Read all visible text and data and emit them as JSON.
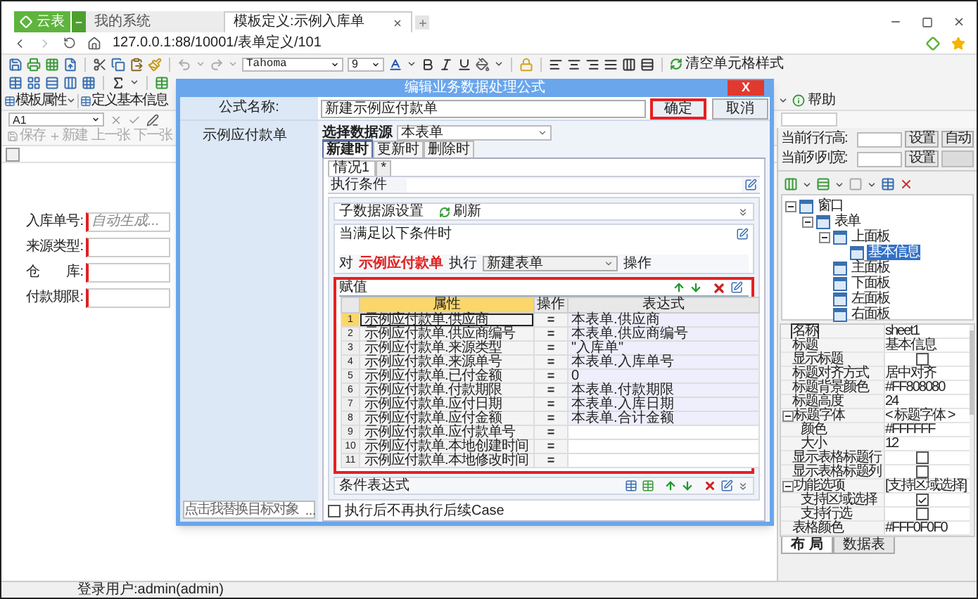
{
  "browser": {
    "tabs": [
      {
        "label": "云表",
        "selected": false,
        "kind": "brand"
      },
      {
        "label": "我的系统",
        "selected": false,
        "kind": "page"
      },
      {
        "label": "模板定义:示例入库单",
        "selected": true,
        "kind": "page"
      }
    ],
    "address": "127.0.0.1:88/10001/表单定义/101"
  },
  "toolbar": {
    "font": "Tahoma",
    "size": "9",
    "clear_style": "清空单元格样式"
  },
  "ribbon": {
    "template_props": "模板属性",
    "basic_info": "定义基本信息",
    "help": "帮助"
  },
  "formula_bar": {
    "cell": "A1"
  },
  "form_toolbar": [
    {
      "label": "保存",
      "disabled": true
    },
    {
      "label": "新建",
      "disabled": true
    },
    {
      "label": "上一张",
      "disabled": true
    },
    {
      "label": "下一张",
      "disabled": true
    }
  ],
  "sheet_fields": [
    {
      "label": "入库单号:",
      "placeholder": "自动生成..."
    },
    {
      "label": "来源类型:"
    },
    {
      "label": "仓　　库:"
    },
    {
      "label": "付款期限:"
    }
  ],
  "right_panel": {
    "size_rows": [
      {
        "label": "当前行行高:",
        "buttons": [
          "设置",
          "自动"
        ]
      },
      {
        "label": "当前列列宽:",
        "buttons": [
          "设置"
        ]
      }
    ],
    "tree": [
      {
        "label": "窗口",
        "selected": false,
        "expanded": true,
        "children": [
          {
            "label": "表单",
            "selected": false,
            "expanded": true,
            "children": [
              {
                "label": "上面板",
                "selected": false,
                "expanded": true,
                "children": [
                  {
                    "label": "基本信息",
                    "selected": true
                  }
                ]
              },
              {
                "label": "主面板",
                "selected": false
              },
              {
                "label": "下面板",
                "selected": false
              },
              {
                "label": "左面板",
                "selected": false
              },
              {
                "label": "右面板",
                "selected": false
              }
            ]
          }
        ]
      }
    ],
    "properties": [
      {
        "name": "名称",
        "value": "sheet1",
        "selected": true
      },
      {
        "name": "标题",
        "value": "基本信息",
        "selected": false
      },
      {
        "name": "显示标题",
        "kind": "check",
        "checked": false,
        "selected": false
      },
      {
        "name": "标题对齐方式",
        "value": "居中对齐",
        "selected": false
      },
      {
        "name": "标题背景颜色",
        "value": "#FF808080",
        "selected": false
      },
      {
        "name": "标题高度",
        "value": "24",
        "selected": false
      },
      {
        "name": "标题字体",
        "value": "< 标题字体 >",
        "kind": "group",
        "expanded": true,
        "selected": false,
        "children": [
          {
            "name": "颜色",
            "value": "#FFFFFF",
            "selected": false
          },
          {
            "name": "大小",
            "value": "12",
            "selected": false
          }
        ]
      },
      {
        "name": "显示表格标题行",
        "kind": "check",
        "checked": false,
        "selected": false
      },
      {
        "name": "显示表格标题列",
        "kind": "check",
        "checked": false,
        "selected": false
      },
      {
        "name": "功能选项",
        "value": "[支持区域选择]",
        "kind": "group",
        "expanded": true,
        "selected": false,
        "children": [
          {
            "name": "支持区域选择",
            "kind": "check",
            "checked": true,
            "selected": false
          },
          {
            "name": "支持行选",
            "kind": "check",
            "checked": false,
            "selected": false
          }
        ]
      },
      {
        "name": "表格颜色",
        "value": "#FFF0F0F0",
        "selected": false
      }
    ],
    "tabs": [
      {
        "label": "布 局",
        "selected": true
      },
      {
        "label": "数据表",
        "selected": false
      }
    ]
  },
  "dialog": {
    "title": "编辑业务数据处理公式",
    "close": "X",
    "name_label": "公式名称:",
    "name_value": "新建示例应付款单",
    "buttons": [
      {
        "label": "确定",
        "highlighted": true
      },
      {
        "label": "取消",
        "highlighted": false
      }
    ],
    "target": "示例应付款单",
    "replace_field": {
      "placeholder": "点击我替换目标对象",
      "more": "..."
    },
    "source_label": "选择数据源",
    "source_value": "本表单",
    "event_tabs": [
      {
        "label": "新建时",
        "selected": true
      },
      {
        "label": "更新时",
        "selected": false
      },
      {
        "label": "删除时",
        "selected": false
      }
    ],
    "case_tabs": [
      {
        "label": "情况1",
        "selected": true
      },
      {
        "label": "*",
        "selected": false
      }
    ],
    "exec_condition": "执行条件",
    "sub_source": {
      "title": "子数据源设置",
      "refresh": "刷新"
    },
    "condition_title": "当满足以下条件时",
    "action": {
      "prefix": "对",
      "target": "示例应付款单",
      "verb": "执行",
      "mode": "新建表单",
      "suffix": "操作"
    },
    "assign": {
      "title": "赋值",
      "highlighted": true,
      "columns": [
        "属性",
        "操作",
        "表达式"
      ],
      "rows": [
        {
          "index": "1",
          "property": "示例应付款单.供应商",
          "op": "=",
          "expression": "本表单.供应商",
          "selected": true
        },
        {
          "index": "2",
          "property": "示例应付款单.供应商编号",
          "op": "=",
          "expression": "本表单.供应商编号",
          "selected": false
        },
        {
          "index": "3",
          "property": "示例应付款单.来源类型",
          "op": "=",
          "expression": "\"入库单\"",
          "selected": false
        },
        {
          "index": "4",
          "property": "示例应付款单.来源单号",
          "op": "=",
          "expression": "本表单.入库单号",
          "selected": false
        },
        {
          "index": "5",
          "property": "示例应付款单.已付金额",
          "op": "=",
          "expression": "0",
          "selected": false
        },
        {
          "index": "6",
          "property": "示例应付款单.付款期限",
          "op": "=",
          "expression": "本表单.付款期限",
          "selected": false
        },
        {
          "index": "7",
          "property": "示例应付款单.应付日期",
          "op": "=",
          "expression": "本表单.入库日期",
          "selected": false
        },
        {
          "index": "8",
          "property": "示例应付款单.应付金额",
          "op": "=",
          "expression": "本表单.合计金额",
          "selected": false
        },
        {
          "index": "9",
          "property": "示例应付款单.应付款单号",
          "op": "=",
          "selected": false
        },
        {
          "index": "10",
          "property": "示例应付款单.本地创建时间",
          "op": "=",
          "selected": false
        },
        {
          "index": "11",
          "property": "示例应付款单.本地修改时间",
          "op": "=",
          "selected": false
        }
      ]
    },
    "condition_expr": "条件表达式",
    "stop_after": {
      "label": "执行后不再执行后续Case",
      "checked": false
    }
  },
  "status_bar": {
    "user": "登录用户:admin(admin)"
  }
}
